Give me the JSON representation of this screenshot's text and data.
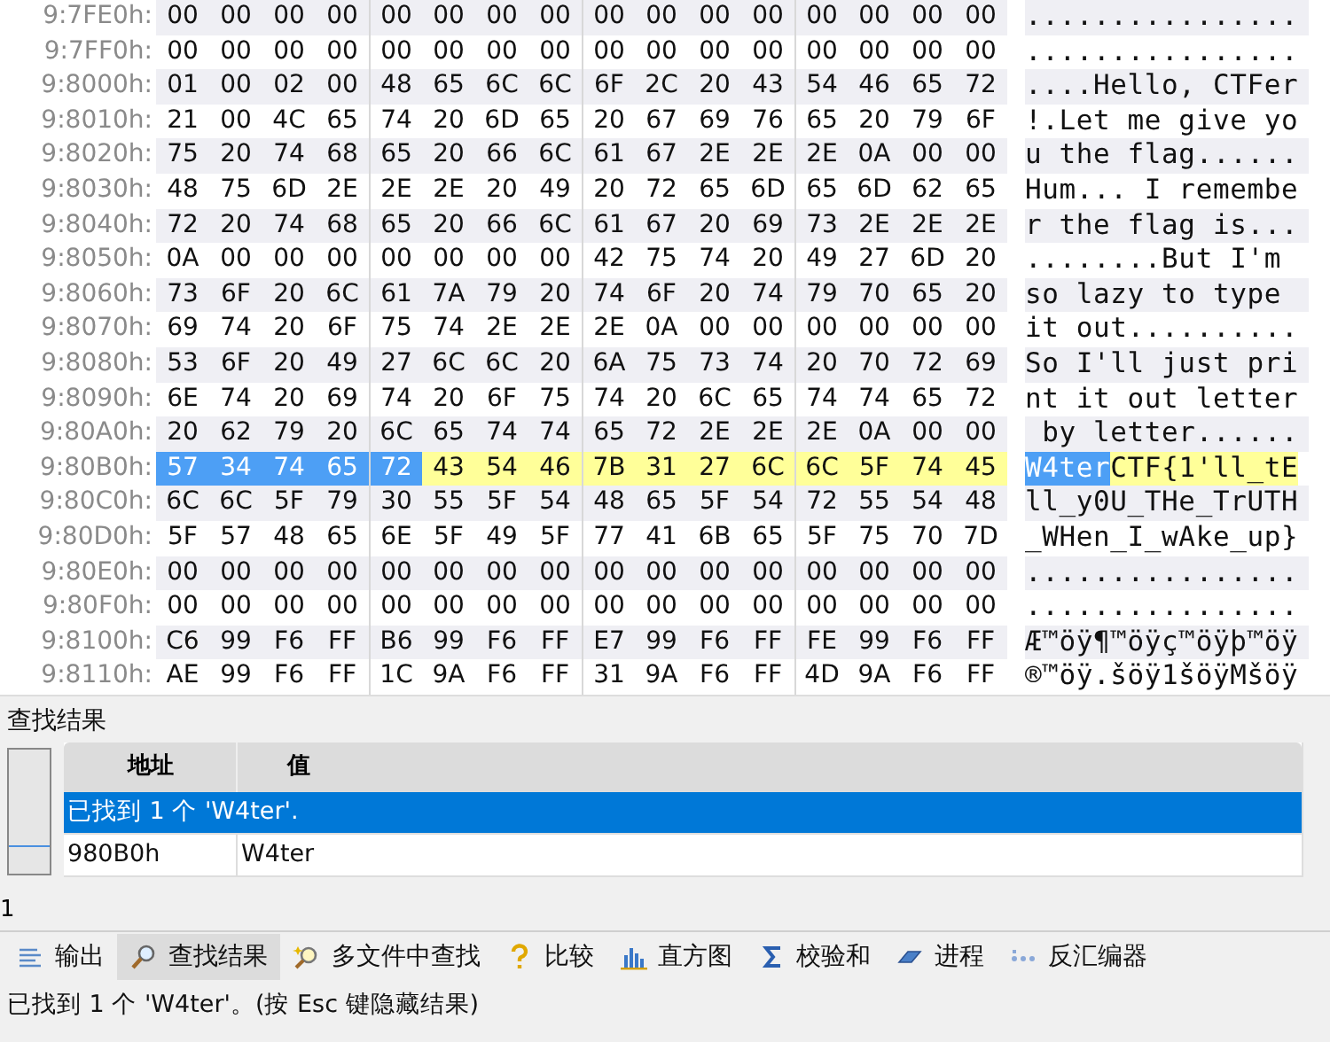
{
  "hex_view": {
    "rows": [
      {
        "address": "9:7FE0h:",
        "segments": [
          {
            "kind": "plain",
            "bytes": [
              "00",
              "00",
              "00",
              "00",
              "00",
              "00",
              "00",
              "00",
              "00",
              "00",
              "00",
              "00",
              "00",
              "00",
              "00",
              "00"
            ],
            "ascii": "................"
          }
        ]
      },
      {
        "address": "9:7FF0h:",
        "segments": [
          {
            "kind": "plain",
            "bytes": [
              "00",
              "00",
              "00",
              "00",
              "00",
              "00",
              "00",
              "00",
              "00",
              "00",
              "00",
              "00",
              "00",
              "00",
              "00",
              "00"
            ],
            "ascii": "................"
          }
        ]
      },
      {
        "address": "9:8000h:",
        "segments": [
          {
            "kind": "plain",
            "bytes": [
              "01",
              "00",
              "02",
              "00",
              "48",
              "65",
              "6C",
              "6C",
              "6F",
              "2C",
              "20",
              "43",
              "54",
              "46",
              "65",
              "72"
            ],
            "ascii": "....Hello, CTFer"
          }
        ]
      },
      {
        "address": "9:8010h:",
        "segments": [
          {
            "kind": "plain",
            "bytes": [
              "21",
              "00",
              "4C",
              "65",
              "74",
              "20",
              "6D",
              "65",
              "20",
              "67",
              "69",
              "76",
              "65",
              "20",
              "79",
              "6F"
            ],
            "ascii": "!.Let me give yo"
          }
        ]
      },
      {
        "address": "9:8020h:",
        "segments": [
          {
            "kind": "plain",
            "bytes": [
              "75",
              "20",
              "74",
              "68",
              "65",
              "20",
              "66",
              "6C",
              "61",
              "67",
              "2E",
              "2E",
              "2E",
              "0A",
              "00",
              "00"
            ],
            "ascii": "u the flag......"
          }
        ]
      },
      {
        "address": "9:8030h:",
        "segments": [
          {
            "kind": "plain",
            "bytes": [
              "48",
              "75",
              "6D",
              "2E",
              "2E",
              "2E",
              "20",
              "49",
              "20",
              "72",
              "65",
              "6D",
              "65",
              "6D",
              "62",
              "65"
            ],
            "ascii": "Hum... I remembe"
          }
        ]
      },
      {
        "address": "9:8040h:",
        "segments": [
          {
            "kind": "plain",
            "bytes": [
              "72",
              "20",
              "74",
              "68",
              "65",
              "20",
              "66",
              "6C",
              "61",
              "67",
              "20",
              "69",
              "73",
              "2E",
              "2E",
              "2E"
            ],
            "ascii": "r the flag is..."
          }
        ]
      },
      {
        "address": "9:8050h:",
        "segments": [
          {
            "kind": "plain",
            "bytes": [
              "0A",
              "00",
              "00",
              "00",
              "00",
              "00",
              "00",
              "00",
              "42",
              "75",
              "74",
              "20",
              "49",
              "27",
              "6D",
              "20"
            ],
            "ascii": "........But I'm"
          }
        ]
      },
      {
        "address": "9:8060h:",
        "segments": [
          {
            "kind": "plain",
            "bytes": [
              "73",
              "6F",
              "20",
              "6C",
              "61",
              "7A",
              "79",
              "20",
              "74",
              "6F",
              "20",
              "74",
              "79",
              "70",
              "65",
              "20"
            ],
            "ascii": "so lazy to type"
          }
        ]
      },
      {
        "address": "9:8070h:",
        "segments": [
          {
            "kind": "plain",
            "bytes": [
              "69",
              "74",
              "20",
              "6F",
              "75",
              "74",
              "2E",
              "2E",
              "2E",
              "0A",
              "00",
              "00",
              "00",
              "00",
              "00",
              "00"
            ],
            "ascii": "it out.........."
          }
        ]
      },
      {
        "address": "9:8080h:",
        "segments": [
          {
            "kind": "plain",
            "bytes": [
              "53",
              "6F",
              "20",
              "49",
              "27",
              "6C",
              "6C",
              "20",
              "6A",
              "75",
              "73",
              "74",
              "20",
              "70",
              "72",
              "69"
            ],
            "ascii": "So I'll just pri"
          }
        ]
      },
      {
        "address": "9:8090h:",
        "segments": [
          {
            "kind": "plain",
            "bytes": [
              "6E",
              "74",
              "20",
              "69",
              "74",
              "20",
              "6F",
              "75",
              "74",
              "20",
              "6C",
              "65",
              "74",
              "74",
              "65",
              "72"
            ],
            "ascii": "nt it out letter"
          }
        ]
      },
      {
        "address": "9:80A0h:",
        "segments": [
          {
            "kind": "plain",
            "bytes": [
              "20",
              "62",
              "79",
              "20",
              "6C",
              "65",
              "74",
              "74",
              "65",
              "72",
              "2E",
              "2E",
              "2E",
              "0A",
              "00",
              "00"
            ],
            "ascii": " by letter......"
          }
        ]
      },
      {
        "address": "9:80B0h:",
        "segments": [
          {
            "kind": "selected",
            "bytes": [
              "57",
              "34",
              "74",
              "65",
              "72"
            ],
            "ascii": "W4ter"
          },
          {
            "kind": "match",
            "bytes": [
              "43",
              "54",
              "46",
              "7B",
              "31",
              "27",
              "6C",
              "6C",
              "5F",
              "74",
              "45"
            ],
            "ascii": "CTF{1'll_tE"
          }
        ]
      },
      {
        "address": "9:80C0h:",
        "segments": [
          {
            "kind": "plain",
            "bytes": [
              "6C",
              "6C",
              "5F",
              "79",
              "30",
              "55",
              "5F",
              "54",
              "48",
              "65",
              "5F",
              "54",
              "72",
              "55",
              "54",
              "48"
            ],
            "ascii": "ll_y0U_THe_TrUTH"
          }
        ]
      },
      {
        "address": "9:80D0h:",
        "segments": [
          {
            "kind": "plain",
            "bytes": [
              "5F",
              "57",
              "48",
              "65",
              "6E",
              "5F",
              "49",
              "5F",
              "77",
              "41",
              "6B",
              "65",
              "5F",
              "75",
              "70",
              "7D"
            ],
            "ascii": "_WHen_I_wAke_up}"
          }
        ]
      },
      {
        "address": "9:80E0h:",
        "segments": [
          {
            "kind": "plain",
            "bytes": [
              "00",
              "00",
              "00",
              "00",
              "00",
              "00",
              "00",
              "00",
              "00",
              "00",
              "00",
              "00",
              "00",
              "00",
              "00",
              "00"
            ],
            "ascii": "................"
          }
        ]
      },
      {
        "address": "9:80F0h:",
        "segments": [
          {
            "kind": "plain",
            "bytes": [
              "00",
              "00",
              "00",
              "00",
              "00",
              "00",
              "00",
              "00",
              "00",
              "00",
              "00",
              "00",
              "00",
              "00",
              "00",
              "00"
            ],
            "ascii": "................"
          }
        ]
      },
      {
        "address": "9:8100h:",
        "segments": [
          {
            "kind": "plain",
            "bytes": [
              "C6",
              "99",
              "F6",
              "FF",
              "B6",
              "99",
              "F6",
              "FF",
              "E7",
              "99",
              "F6",
              "FF",
              "FE",
              "99",
              "F6",
              "FF"
            ],
            "ascii": "Æ™öÿ¶™öÿç™öÿþ™öÿ"
          }
        ]
      },
      {
        "address": "9:8110h:",
        "segments": [
          {
            "kind": "plain",
            "bytes": [
              "AE",
              "99",
              "F6",
              "FF",
              "1C",
              "9A",
              "F6",
              "FF",
              "31",
              "9A",
              "F6",
              "FF",
              "4D",
              "9A",
              "F6",
              "FF"
            ],
            "ascii": "®™öÿ.šöÿ1šöÿMšöÿ"
          }
        ]
      }
    ]
  },
  "results_panel": {
    "title": "查找结果",
    "columns": [
      "地址",
      "值"
    ],
    "rows": [
      {
        "kind": "summary",
        "text": "已找到 1 个 'W4ter'.",
        "selected": true
      },
      {
        "kind": "match",
        "cells": [
          "980B0h",
          "W4ter"
        ],
        "selected": false
      }
    ],
    "count": "1"
  },
  "tabs": [
    {
      "label": "输出",
      "selected": false
    },
    {
      "label": "查找结果",
      "selected": true
    },
    {
      "label": "多文件中查找",
      "selected": false
    },
    {
      "label": "比较",
      "selected": false
    },
    {
      "label": "直方图",
      "selected": false
    },
    {
      "label": "校验和",
      "selected": false
    },
    {
      "label": "进程",
      "selected": false
    },
    {
      "label": "反汇编器",
      "selected": false
    }
  ],
  "status_bar": "已找到 1 个 'W4ter'。(按 Esc 键隐藏结果)"
}
